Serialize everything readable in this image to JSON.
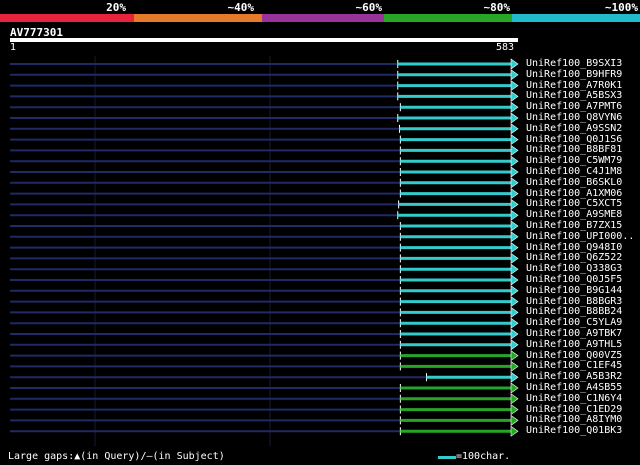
{
  "scale": {
    "ticks": [
      {
        "label": "20%",
        "pos": 20
      },
      {
        "label": "~40%",
        "pos": 40
      },
      {
        "label": "~60%",
        "pos": 60
      },
      {
        "label": "~80%",
        "pos": 80
      },
      {
        "label": "~100%",
        "pos": 100
      }
    ],
    "bands": [
      {
        "from": 0,
        "to": 21,
        "color": "#e8243c"
      },
      {
        "from": 21,
        "to": 41,
        "color": "#e57a28"
      },
      {
        "from": 41,
        "to": 60,
        "color": "#993399"
      },
      {
        "from": 60,
        "to": 80,
        "color": "#27a527"
      },
      {
        "from": 80,
        "to": 100,
        "color": "#22bbcc"
      }
    ]
  },
  "query": {
    "name": "AV777301",
    "start": "1",
    "end": "583",
    "length": 583
  },
  "hits": [
    {
      "name": "UniRef100_B9SXI3",
      "start": 445,
      "color": "#33cccc"
    },
    {
      "name": "UniRef100_B9HFR9",
      "start": 445,
      "color": "#33cccc"
    },
    {
      "name": "UniRef100_A7R0K1",
      "start": 445,
      "color": "#33cccc"
    },
    {
      "name": "UniRef100_A5BSX3",
      "start": 445,
      "color": "#33cccc"
    },
    {
      "name": "UniRef100_A7PMT6",
      "start": 448,
      "color": "#33cccc"
    },
    {
      "name": "UniRef100_Q8VYN6",
      "start": 445,
      "color": "#33cccc"
    },
    {
      "name": "UniRef100_A9SSN2",
      "start": 447,
      "color": "#33cccc"
    },
    {
      "name": "UniRef100_Q0J1S6",
      "start": 448,
      "color": "#33cccc"
    },
    {
      "name": "UniRef100_B8BF81",
      "start": 448,
      "color": "#33cccc"
    },
    {
      "name": "UniRef100_C5WM79",
      "start": 448,
      "color": "#33cccc"
    },
    {
      "name": "UniRef100_C4J1M8",
      "start": 448,
      "color": "#33cccc"
    },
    {
      "name": "UniRef100_B6SKL0",
      "start": 448,
      "color": "#33cccc"
    },
    {
      "name": "UniRef100_A1XM06",
      "start": 448,
      "color": "#33cccc"
    },
    {
      "name": "UniRef100_C5XCT5",
      "start": 446,
      "color": "#33cccc"
    },
    {
      "name": "UniRef100_A9SME8",
      "start": 445,
      "color": "#33cccc"
    },
    {
      "name": "UniRef100_B7ZX15",
      "start": 448,
      "color": "#33cccc"
    },
    {
      "name": "UniRef100_UPI000..",
      "start": 448,
      "color": "#33cccc"
    },
    {
      "name": "UniRef100_Q948I0",
      "start": 448,
      "color": "#33cccc"
    },
    {
      "name": "UniRef100_Q6Z522",
      "start": 448,
      "color": "#33cccc"
    },
    {
      "name": "UniRef100_Q338G3",
      "start": 448,
      "color": "#33cccc"
    },
    {
      "name": "UniRef100_Q0J5F5",
      "start": 448,
      "color": "#33cccc"
    },
    {
      "name": "UniRef100_B9G144",
      "start": 448,
      "color": "#33cccc"
    },
    {
      "name": "UniRef100_B8BGR3",
      "start": 448,
      "color": "#33cccc"
    },
    {
      "name": "UniRef100_B8BB24",
      "start": 448,
      "color": "#33cccc"
    },
    {
      "name": "UniRef100_C5YLA9",
      "start": 448,
      "color": "#33cccc"
    },
    {
      "name": "UniRef100_A9TBK7",
      "start": 448,
      "color": "#33cccc"
    },
    {
      "name": "UniRef100_A9THL5",
      "start": 448,
      "color": "#33cccc"
    },
    {
      "name": "UniRef100_Q00VZ5",
      "start": 448,
      "color": "#27a527"
    },
    {
      "name": "UniRef100_C1EF45",
      "start": 448,
      "color": "#27a527"
    },
    {
      "name": "UniRef100_A5B3R2",
      "start": 478,
      "color": "#33cccc"
    },
    {
      "name": "UniRef100_A4SB55",
      "start": 448,
      "color": "#27a527"
    },
    {
      "name": "UniRef100_C1N6Y4",
      "start": 448,
      "color": "#27a527"
    },
    {
      "name": "UniRef100_C1ED29",
      "start": 448,
      "color": "#27a527"
    },
    {
      "name": "UniRef100_A8IYM0",
      "start": 448,
      "color": "#27a527"
    },
    {
      "name": "UniRef100_Q01BK3",
      "start": 448,
      "color": "#27a527"
    }
  ],
  "legend": {
    "gaps_text": "Large gaps:▲(in Query)/–(in Subject)",
    "scale_text": "=100char."
  },
  "colors": {
    "background": "#000000",
    "subject_line": "#1f2a66",
    "query_bar": "#ffffff"
  }
}
